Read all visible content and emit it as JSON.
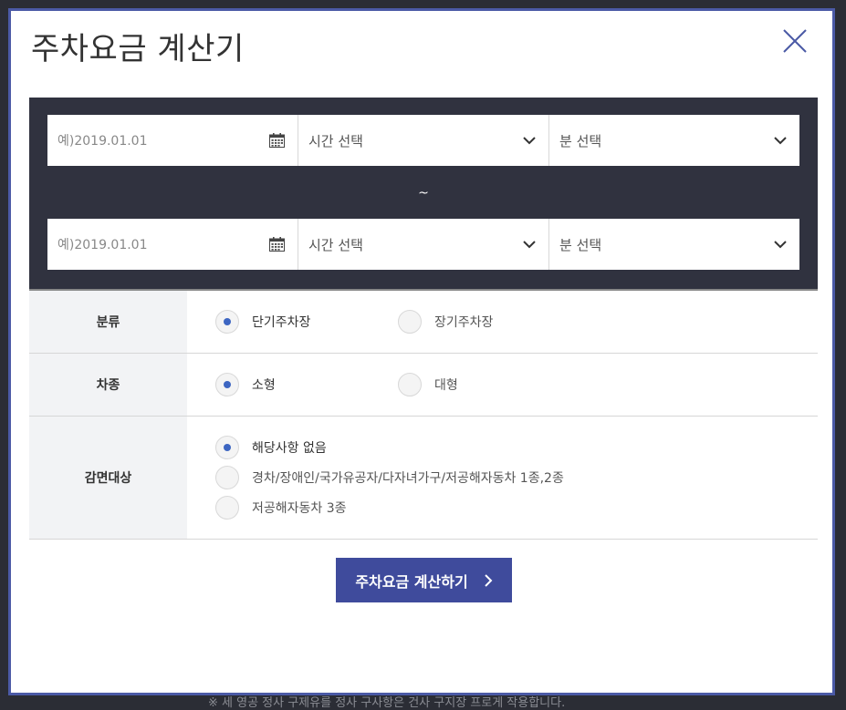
{
  "backdrop": {
    "text": "※ 세 영공 정사 구제유를 정사 구사항은 건사 구지장 프로게 작용합니다."
  },
  "modal": {
    "title": "주차요금 계산기",
    "close_icon": "close-x-icon"
  },
  "range": {
    "start": {
      "date_placeholder": "예)2019.01.01",
      "hour_label": "시간 선택",
      "minute_label": "분 선택"
    },
    "separator": "~",
    "end": {
      "date_placeholder": "예)2019.01.01",
      "hour_label": "시간 선택",
      "minute_label": "분 선택"
    }
  },
  "options": {
    "category": {
      "label": "분류",
      "choices": [
        {
          "label": "단기주차장",
          "checked": true
        },
        {
          "label": "장기주차장",
          "checked": false
        }
      ]
    },
    "vehicle": {
      "label": "차종",
      "choices": [
        {
          "label": "소형",
          "checked": true
        },
        {
          "label": "대형",
          "checked": false
        }
      ]
    },
    "discount": {
      "label": "감면대상",
      "choices": [
        {
          "label": "해당사항 없음",
          "checked": true
        },
        {
          "label": "경차/장애인/국가유공자/다자녀가구/저공해자동차 1종,2종",
          "checked": false
        },
        {
          "label": "저공해자동차 3종",
          "checked": false
        }
      ]
    }
  },
  "actions": {
    "calculate_label": "주차요금 계산하기"
  },
  "colors": {
    "accent": "#3f4b9c",
    "modal_border": "#4b5aa6",
    "range_bg": "#30323f",
    "radio_dot": "#3d66c2"
  }
}
